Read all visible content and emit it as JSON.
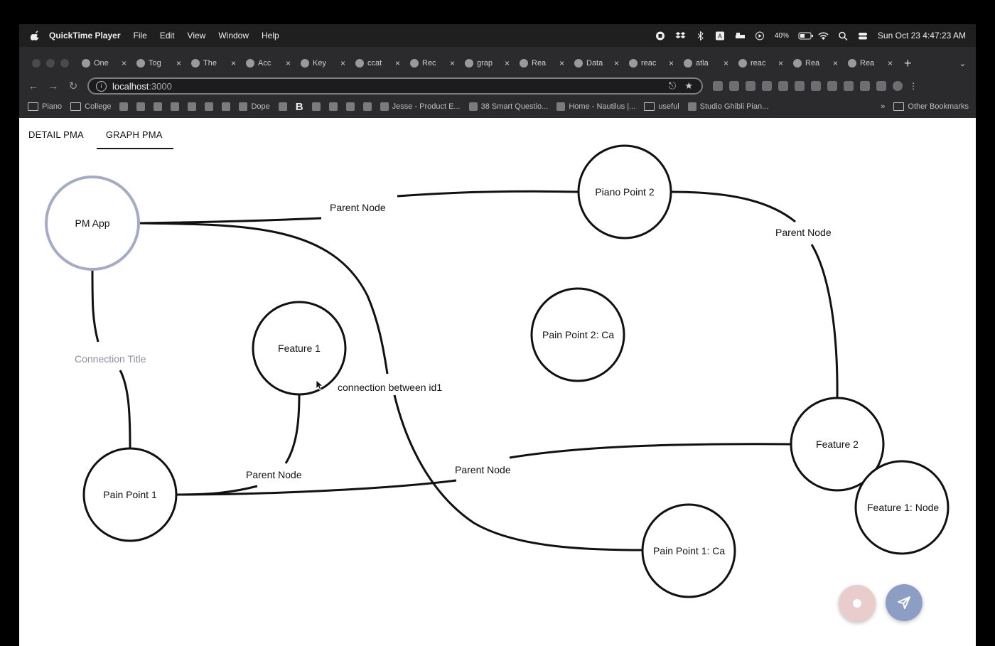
{
  "menubar": {
    "app_name": "QuickTime Player",
    "menus": [
      "File",
      "Edit",
      "View",
      "Window",
      "Help"
    ],
    "battery": "40%",
    "clock": "Sun Oct 23  4:47:23 AM"
  },
  "browser": {
    "tabs": [
      {
        "label": "One",
        "icon": "diamond-icon"
      },
      {
        "label": "Tog",
        "icon": "toggl-icon"
      },
      {
        "label": "The",
        "icon": "notion-icon"
      },
      {
        "label": "Acc",
        "icon": "react-icon"
      },
      {
        "label": "Key",
        "icon": "react-icon"
      },
      {
        "label": "ccat",
        "icon": "github-icon"
      },
      {
        "label": "Rec",
        "icon": "figma-icon"
      },
      {
        "label": "grap",
        "icon": "hand-icon"
      },
      {
        "label": "Rea",
        "icon": "hand-icon"
      },
      {
        "label": "Data",
        "icon": "pen-icon"
      },
      {
        "label": "reac",
        "icon": "hand-icon"
      },
      {
        "label": "atla",
        "icon": "github-icon"
      },
      {
        "label": "reac",
        "icon": "github-icon"
      },
      {
        "label": "Rea",
        "icon": "react-icon"
      },
      {
        "label": "Rea",
        "icon": "react-icon"
      }
    ],
    "close_glyph": "×",
    "new_tab_glyph": "+",
    "url_host": "localhost",
    "url_port": ":3000",
    "bookmarks": [
      {
        "label": "Piano",
        "kind": "folder"
      },
      {
        "label": "College",
        "kind": "folder"
      },
      {
        "label": "",
        "kind": "favicon"
      },
      {
        "label": "",
        "kind": "favicon"
      },
      {
        "label": "",
        "kind": "favicon"
      },
      {
        "label": "",
        "kind": "favicon"
      },
      {
        "label": "",
        "kind": "favicon"
      },
      {
        "label": "",
        "kind": "favicon"
      },
      {
        "label": "",
        "kind": "favicon"
      },
      {
        "label": "Dope",
        "kind": "favicon"
      },
      {
        "label": "",
        "kind": "favicon"
      },
      {
        "label": "B",
        "kind": "text"
      },
      {
        "label": "",
        "kind": "favicon"
      },
      {
        "label": "",
        "kind": "favicon"
      },
      {
        "label": "",
        "kind": "favicon"
      },
      {
        "label": "",
        "kind": "favicon"
      },
      {
        "label": "Jesse - Product E...",
        "kind": "favicon"
      },
      {
        "label": "38 Smart Questio...",
        "kind": "favicon"
      },
      {
        "label": "Home - Nautilus |...",
        "kind": "favicon"
      },
      {
        "label": "useful",
        "kind": "folder"
      },
      {
        "label": "Studio Ghibli Pian...",
        "kind": "favicon"
      }
    ],
    "more_bookmarks": "»",
    "other_bookmarks": "Other Bookmarks"
  },
  "page": {
    "tabs": [
      {
        "label": "DETAIL PMA",
        "active": false
      },
      {
        "label": "GRAPH PMA",
        "active": true
      }
    ]
  },
  "graph": {
    "nodes": [
      {
        "id": "pm-app",
        "label": "PM App"
      },
      {
        "id": "piano-point-2",
        "label": "Piano Point 2"
      },
      {
        "id": "feature-1",
        "label": "Feature 1"
      },
      {
        "id": "pain-point-2",
        "label": "Pain Point 2: Ca"
      },
      {
        "id": "feature-2",
        "label": "Feature 2"
      },
      {
        "id": "feature-1-node",
        "label": "Feature 1: Node"
      },
      {
        "id": "pain-point-1",
        "label": "Pain Point 1"
      },
      {
        "id": "pain-point-1-c",
        "label": "Pain Point 1: Ca"
      }
    ],
    "edge_labels": [
      {
        "id": "pm-to-piano",
        "text": "Parent Node"
      },
      {
        "id": "piano-to-feature2",
        "text": "Parent Node"
      },
      {
        "id": "pm-to-painpoint1",
        "text": "Connection Title"
      },
      {
        "id": "pm-to-pp1c",
        "text": "connection between id1"
      },
      {
        "id": "feature1-to-painpoint1",
        "text": "Parent Node"
      },
      {
        "id": "painpoint1-to-feature2",
        "text": "Parent Node"
      }
    ]
  },
  "colors": {
    "selected_node_stroke": "#a4abc6",
    "edge_title_muted": "#8f8f9c",
    "fab_record": "#e9cdcd",
    "fab_send": "#8d9ec4"
  }
}
